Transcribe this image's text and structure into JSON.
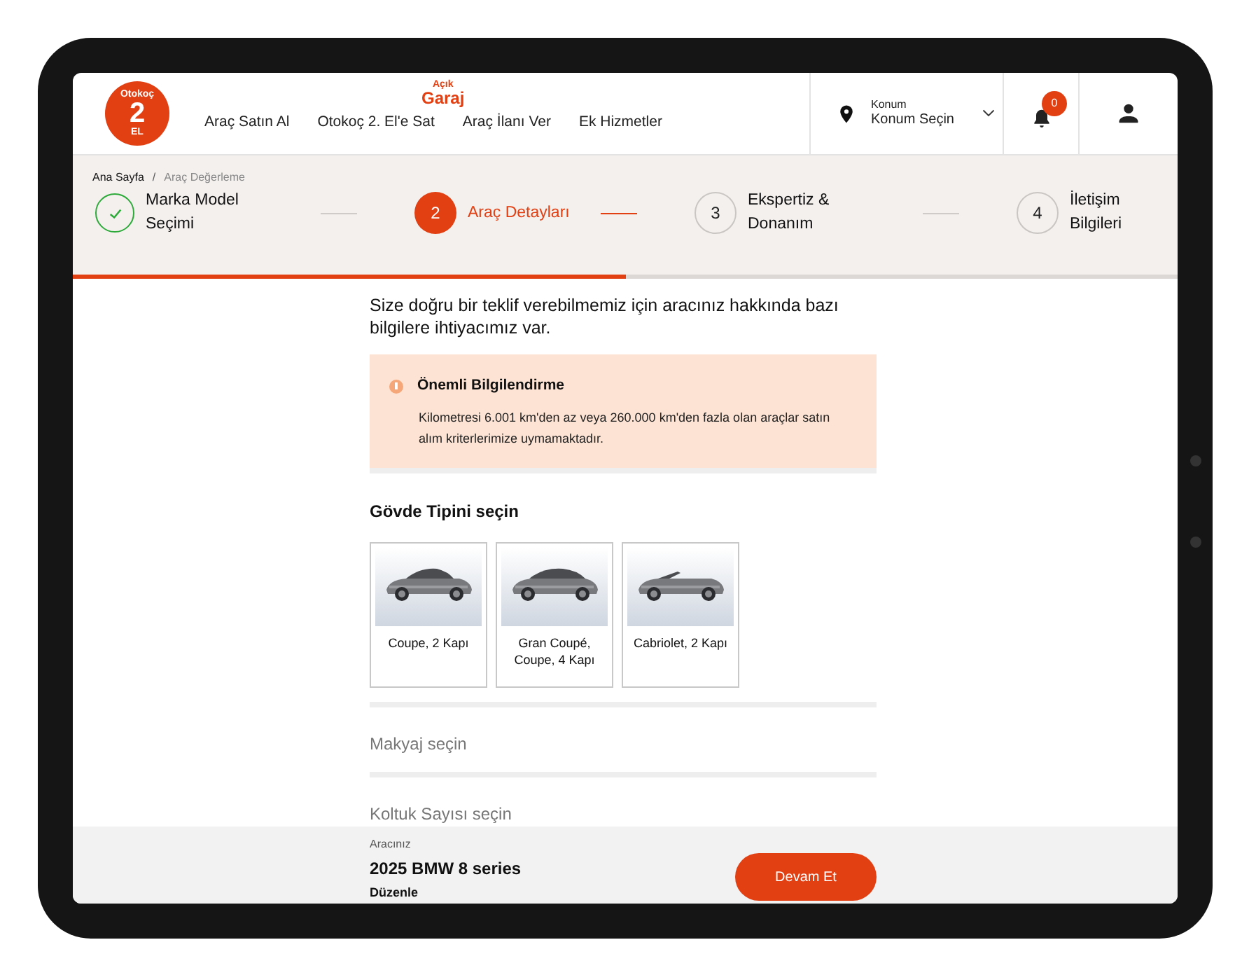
{
  "logo": {
    "top": "Otokoç",
    "number": "2",
    "bottom": "EL"
  },
  "promo": {
    "top": "Açık",
    "bottom": "Garaj"
  },
  "nav": [
    {
      "label": "Araç Satın Al"
    },
    {
      "label": "Otokoç 2. El'e Sat"
    },
    {
      "label": "Araç İlanı Ver"
    },
    {
      "label": "Ek Hizmetler"
    }
  ],
  "location": {
    "label": "Konum",
    "value": "Konum Seçin"
  },
  "notifications": {
    "count": "0"
  },
  "breadcrumb": [
    {
      "label": "Ana Sayfa"
    },
    {
      "label": "Araç Değerleme"
    }
  ],
  "breadcrumb_separator": "/",
  "steps": [
    {
      "kind": "done",
      "label": "Marka Model Seçimi"
    },
    {
      "kind": "active",
      "number": "2",
      "label": "Araç Detayları"
    },
    {
      "kind": "pending",
      "number": "3",
      "label": "Ekspertiz & Donanım"
    },
    {
      "kind": "pending",
      "number": "4",
      "label": "İletişim Bilgileri"
    }
  ],
  "progress": {
    "level": 0.5
  },
  "intro": "Size doğru bir teklif verebilmemiz için aracınız hakkında bazı bilgilere ihtiyacımız var.",
  "notice": {
    "title": "Önemli Bilgilendirme",
    "text": "Kilometresi 6.001 km'den az veya 260.000 km'den fazla olan araçlar satın alım kriterlerimize uymamaktadır."
  },
  "body_type": {
    "title": "Gövde Tipini seçin",
    "options": [
      {
        "label": "Coupe, 2 Kapı",
        "selected": false
      },
      {
        "label": "Gran Coupé, Coupe, 4 Kapı",
        "selected": false
      },
      {
        "label": "Cabriolet, 2 Kapı",
        "selected": false
      }
    ]
  },
  "sections": [
    {
      "title": "Makyaj seçin"
    },
    {
      "title": "Koltuk Sayısı seçin"
    }
  ],
  "footer": {
    "caption": "Aracınız",
    "vehicle": "2025 BMW 8 series",
    "edit": "Düzenle",
    "button": "Devam Et"
  }
}
